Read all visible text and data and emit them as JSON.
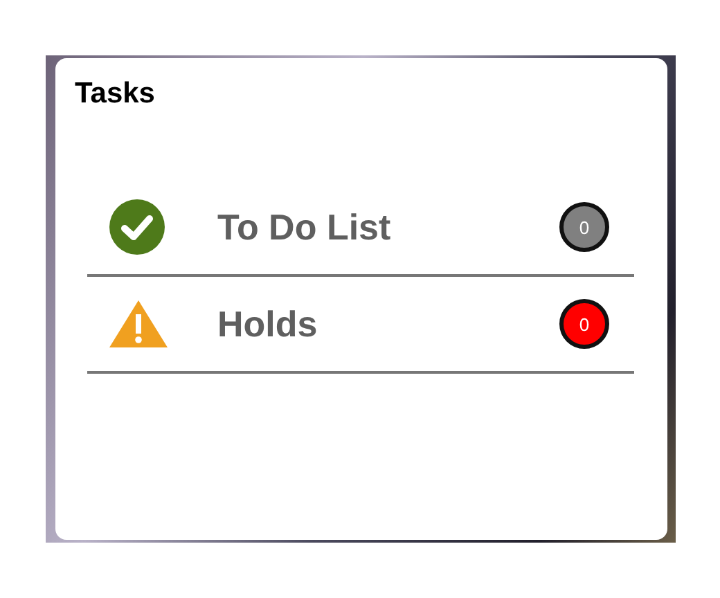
{
  "card": {
    "title": "Tasks"
  },
  "items": [
    {
      "kind": "todo",
      "label": "To Do List",
      "count": "0",
      "color": "#808080"
    },
    {
      "kind": "hold",
      "label": "Holds",
      "count": "0",
      "color": "#ff0000"
    }
  ]
}
